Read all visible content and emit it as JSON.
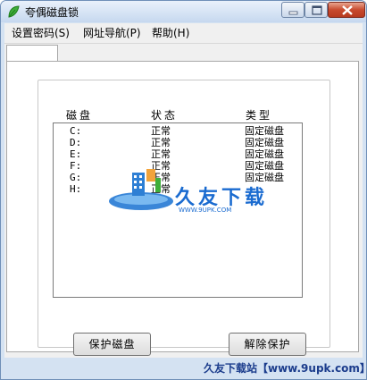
{
  "window": {
    "title": "夸偶磁盘锁"
  },
  "menu": [
    {
      "label": "设置密码(S)"
    },
    {
      "label": "网址导航(P)"
    },
    {
      "label": "帮助(H)"
    }
  ],
  "table": {
    "headers": [
      "磁盘",
      "状态",
      "类型"
    ],
    "rows": [
      {
        "drive": "C:",
        "status": "正常",
        "type": "固定磁盘"
      },
      {
        "drive": "D:",
        "status": "正常",
        "type": "固定磁盘"
      },
      {
        "drive": "E:",
        "status": "正常",
        "type": "固定磁盘"
      },
      {
        "drive": "F:",
        "status": "正常",
        "type": "固定磁盘"
      },
      {
        "drive": "G:",
        "status": "正常",
        "type": "固定磁盘"
      },
      {
        "drive": "H:",
        "status": "正常",
        "type": ""
      }
    ]
  },
  "buttons": {
    "protect": "保护磁盘",
    "release": "解除保护"
  },
  "watermark": {
    "text": "久友下载",
    "url": "WWW.9UPK.COM"
  },
  "credit": "久友下载站【www.9upk.com】",
  "colors": {
    "accent": "#1a6bd0",
    "titlebar": "#c6d8ef",
    "close": "#c84a2e"
  }
}
